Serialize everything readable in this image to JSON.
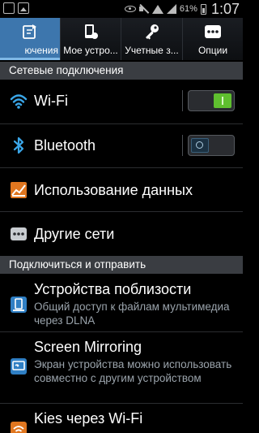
{
  "status_bar": {
    "battery": "61%",
    "time": "1:07",
    "icons": [
      "notification-icon",
      "gallery-icon",
      "eye-icon",
      "mute-icon",
      "wifi-icon",
      "signal-icon",
      "battery-icon"
    ]
  },
  "tabs": [
    {
      "label": "ючения",
      "icon": "connections-icon",
      "active": true
    },
    {
      "label": "Мое устро...",
      "icon": "device-icon",
      "active": false
    },
    {
      "label": "Учетные з...",
      "icon": "key-icon",
      "active": false
    },
    {
      "label": "Опции",
      "icon": "more-icon",
      "active": false
    }
  ],
  "sections": {
    "network": "Сетевые подключения",
    "connect_share": "Подключиться и отправить"
  },
  "items": {
    "wifi": {
      "title": "Wi-Fi",
      "toggle": "on"
    },
    "bluetooth": {
      "title": "Bluetooth",
      "toggle": "off"
    },
    "data_usage": {
      "title": "Использование данных"
    },
    "more_networks": {
      "title": "Другие сети"
    },
    "nearby": {
      "title": "Устройства поблизости",
      "subtitle": "Общий доступ к файлам мультимедиа через DLNA"
    },
    "mirroring": {
      "title": "Screen Mirroring",
      "subtitle": "Экран устройства можно использовать совместно с другим устройством"
    },
    "kies": {
      "title": "Kies через Wi-Fi"
    }
  },
  "colors": {
    "accent": "#3d76ad",
    "toggle_on": "#5fbf2f",
    "section_bg": "#3a3d42",
    "subtitle": "#9aa3ab"
  }
}
